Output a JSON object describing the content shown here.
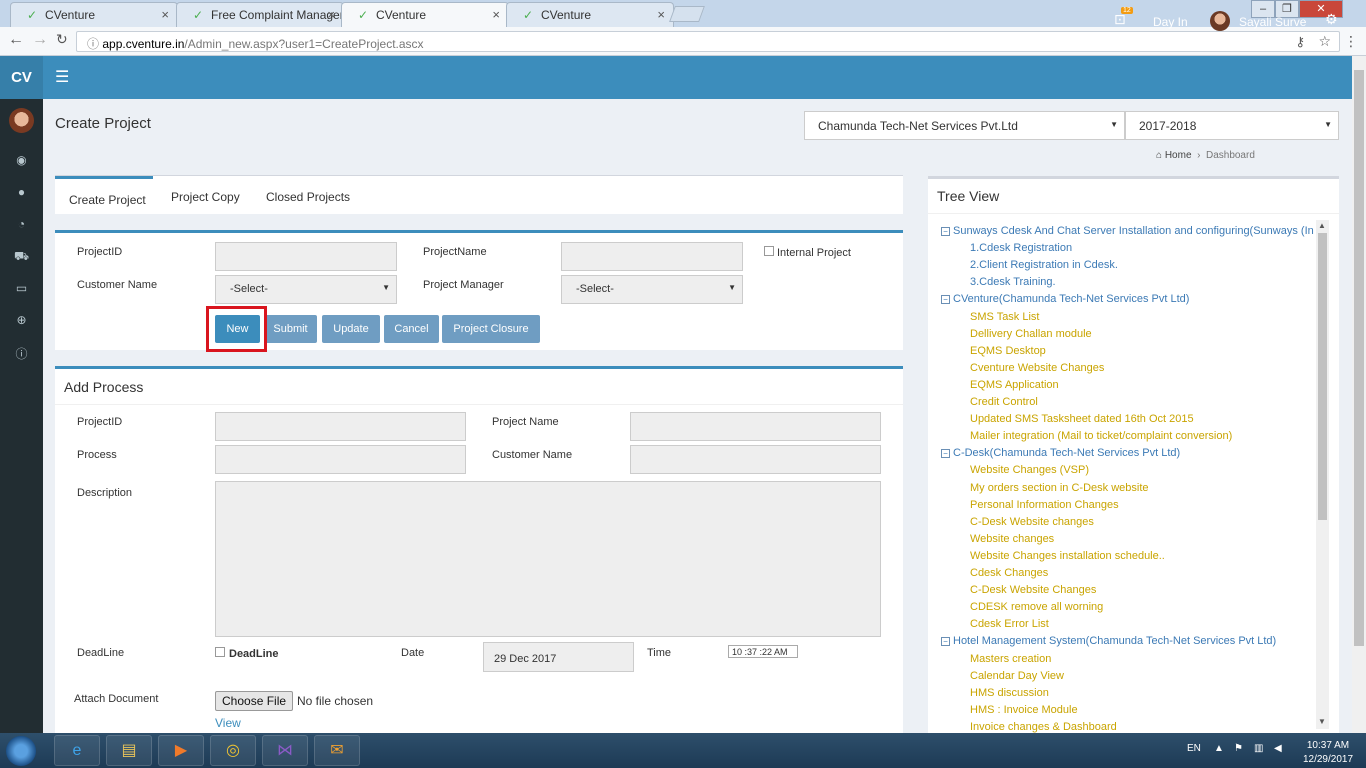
{
  "browser": {
    "tabs": [
      {
        "label": "CVenture"
      },
      {
        "label": "Free Complaint Managem"
      },
      {
        "label": "CVenture"
      },
      {
        "label": "CVenture"
      }
    ],
    "url_host": "app.cventure.in",
    "url_path": "/Admin_new.aspx?user1=CreateProject.ascx"
  },
  "header": {
    "logo": "CV",
    "notification_count": "12",
    "day_in": "Day In",
    "user_name": "Sayali Surve"
  },
  "page": {
    "title": "Create Project",
    "company_select": "Chamunda Tech-Net Services Pvt.Ltd",
    "year_select": "2017-2018",
    "breadcrumb_home": "Home",
    "breadcrumb_current": "Dashboard"
  },
  "tabs": [
    {
      "label": "Create Project"
    },
    {
      "label": "Project Copy"
    },
    {
      "label": "Closed Projects"
    }
  ],
  "create_form": {
    "project_id_label": "ProjectID",
    "project_name_label": "ProjectName",
    "internal_project_label": "Internal Project",
    "customer_name_label": "Customer Name",
    "customer_select": "-Select-",
    "project_manager_label": "Project Manager",
    "manager_select": "-Select-",
    "buttons": {
      "new": "New",
      "submit": "Submit",
      "update": "Update",
      "cancel": "Cancel",
      "closure": "Project Closure"
    }
  },
  "process_form": {
    "title": "Add Process",
    "project_id_label": "ProjectID",
    "project_name_label": "Project Name",
    "process_label": "Process",
    "customer_name_label": "Customer Name",
    "description_label": "Description",
    "deadline_label": "DeadLine",
    "deadline_check_label": "DeadLine",
    "date_label": "Date",
    "date_value": "29 Dec 2017",
    "time_label": "Time",
    "time_value": "10 :37 :22  AM",
    "attach_label": "Attach Document",
    "choose_file": "Choose File",
    "no_file": "No file chosen",
    "view_link": "View"
  },
  "tree": {
    "title": "Tree View",
    "groups": [
      {
        "label": "Sunways Cdesk And Chat Server Installation and configuring(Sunways (In",
        "color": "blue",
        "items": [
          "1.Cdesk Registration",
          "2.Client Registration in Cdesk.",
          "3.Cdesk Training."
        ]
      },
      {
        "label": "CVenture(Chamunda Tech-Net Services Pvt Ltd)",
        "color": "gold",
        "items": [
          "SMS Task List",
          "Dellivery Challan module",
          "EQMS Desktop",
          "Cventure Website Changes",
          "EQMS Application",
          "Credit Control",
          "Updated SMS Tasksheet dated 16th Oct 2015",
          "Mailer integration (Mail to ticket/complaint conversion)"
        ]
      },
      {
        "label": "C-Desk(Chamunda Tech-Net Services Pvt Ltd)",
        "color": "gold",
        "items": [
          "Website Changes (VSP)",
          "My orders section in C-Desk website",
          "Personal Information Changes",
          "C-Desk Website changes",
          "Website changes",
          "Website Changes installation schedule..",
          "Cdesk Changes",
          "C-Desk Website Changes",
          "CDESK remove all worning",
          "Cdesk Error List"
        ]
      },
      {
        "label": "Hotel Management System(Chamunda Tech-Net Services Pvt Ltd)",
        "color": "gold",
        "items": [
          "Masters creation",
          "Calendar Day View",
          "HMS discussion",
          "HMS : Invoice Module",
          "Invoice changes & Dashboard"
        ]
      }
    ]
  },
  "taskbar": {
    "lang": "EN",
    "time": "10:37 AM",
    "date": "12/29/2017"
  },
  "colors": {
    "header_blue": "#3c8dbc",
    "sidebar_dark": "#222d32",
    "highlight_red": "#d9151e",
    "tree_gold": "#c9a400"
  }
}
